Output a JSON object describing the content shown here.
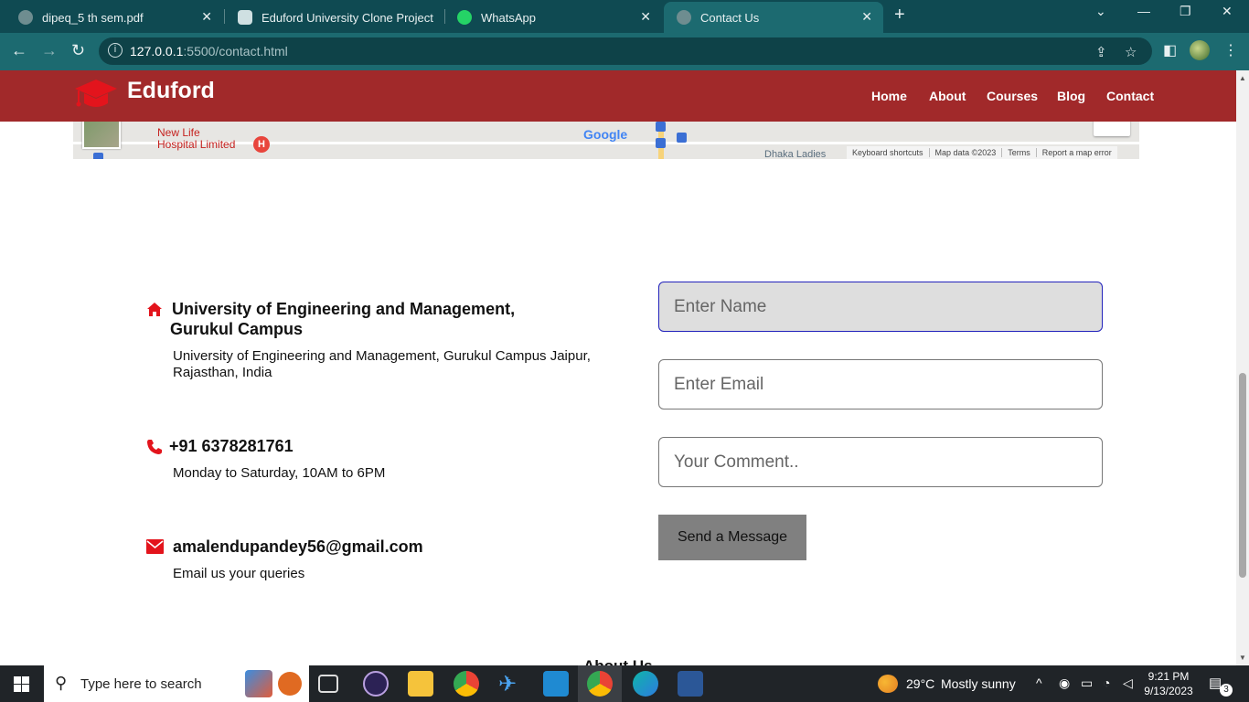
{
  "browser": {
    "tabs": [
      {
        "title": "dipeq_5 th sem.pdf",
        "icon": "globe-icon",
        "close": "✕"
      },
      {
        "title": "Eduford University Clone Project",
        "icon": "chatgpt-icon",
        "close": ""
      },
      {
        "title": "WhatsApp",
        "icon": "whatsapp-icon",
        "close": "✕"
      },
      {
        "title": "Contact Us",
        "icon": "globe-icon",
        "close": "✕"
      }
    ],
    "new_tab": "+",
    "url_host": "127.0.0.1",
    "url_path": ":5500/contact.html"
  },
  "site": {
    "brand": "Eduford",
    "nav": [
      "Home",
      "About",
      "Courses",
      "Blog",
      "Contact"
    ],
    "colors": {
      "nav_bg": "#a1292a",
      "accent": "#e3141c"
    }
  },
  "map": {
    "place_label": "New Life\nHospital Limited",
    "google": "Google",
    "dhaka_label": "Dhaka Ladies",
    "footer": [
      "Keyboard shortcuts",
      "Map data ©2023",
      "Terms",
      "Report a map error"
    ]
  },
  "contact": {
    "address_title": "University of Engineering and Management,",
    "address_title_2": "Gurukul Campus",
    "address_text": "University of Engineering and Management, Gurukul Campus Jaipur,",
    "address_text_2": "Rajasthan, India",
    "phone_title": "+91 6378281761",
    "phone_text": "Monday to Saturday, 10AM to 6PM",
    "email_title": "amalendupandey56@gmail.com",
    "email_text": "Email us your queries"
  },
  "form": {
    "name_placeholder": "Enter Name",
    "email_placeholder": "Enter Email",
    "comment_placeholder": "Your Comment..",
    "submit_label": "Send a Message"
  },
  "next_section_peek": "About Us",
  "taskbar": {
    "search_placeholder": "Type here to search",
    "weather_temp": "29°C",
    "weather_desc": "Mostly sunny",
    "time": "9:21 PM",
    "date": "9/13/2023",
    "notification_count": "3"
  }
}
